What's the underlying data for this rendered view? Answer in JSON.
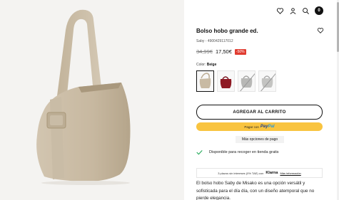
{
  "header": {
    "icons": [
      "heart-icon",
      "user-icon",
      "search-icon",
      "bag-icon"
    ],
    "cart_count": "0"
  },
  "product": {
    "title": "Bolso hobo grande ed.",
    "sku": "Saby - 4900429117012",
    "old_price": "34,99€",
    "price": "17,50€",
    "discount": "-50%",
    "color_label": "Color: ",
    "color_value": "Beige",
    "swatches": [
      {
        "name": "Beige",
        "color": "#c8baa3",
        "selected": true,
        "available": true
      },
      {
        "name": "Burgundy",
        "color": "#8e1a24",
        "selected": false,
        "available": true
      },
      {
        "name": "Grey",
        "color": "#b8b8b6",
        "selected": false,
        "available": false
      },
      {
        "name": "Silver",
        "color": "#c4c4c2",
        "selected": false,
        "available": false
      }
    ]
  },
  "actions": {
    "add_to_cart": "AGREGAR AL CARRITO",
    "paypal_prefix": "Pagar con",
    "paypal_pay": "Pay",
    "paypal_pal": "Pal",
    "more_payment": "Más opciones de pago"
  },
  "availability": "Disponible para recoger en tienda gratis",
  "klarna": {
    "text": "3 plazos sin intereses (0% TAE) con",
    "logo": "Klarna",
    "link": "Más información"
  },
  "description": "El bolso hobo Saby de Misako es una opción versátil y sofisticada para el día día, con un diseño atemporal que no pierde elegancia.",
  "colors": {
    "accent_yellow": "#f9c440",
    "discount_red": "#e03c31",
    "check_green": "#2fae62"
  }
}
